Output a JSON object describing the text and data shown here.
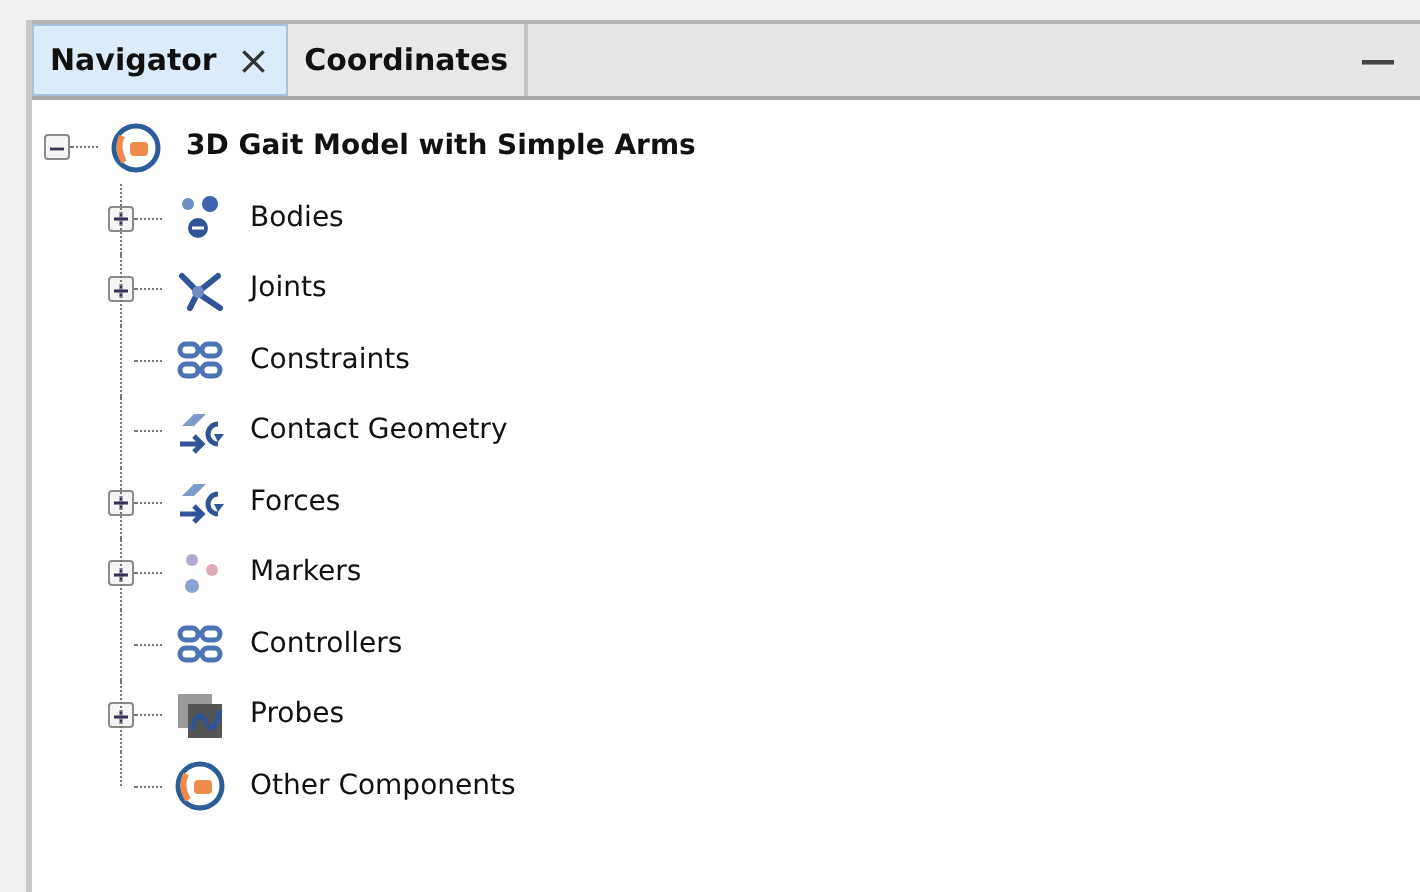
{
  "tabs": [
    {
      "label": "Navigator",
      "selected": true,
      "close": "×"
    },
    {
      "label": "Coordinates",
      "selected": false
    }
  ],
  "minimize": "—",
  "tree": {
    "label": "3D Gait Model with Simple Arms",
    "kind": "opensim",
    "expanded": true,
    "children": [
      {
        "label": "Bodies",
        "kind": "bodies",
        "expanded": false
      },
      {
        "label": "Joints",
        "kind": "joints",
        "expanded": false
      },
      {
        "label": "Constraints",
        "kind": "links"
      },
      {
        "label": "Contact Geometry",
        "kind": "forces"
      },
      {
        "label": "Forces",
        "kind": "forces",
        "expanded": false
      },
      {
        "label": "Markers",
        "kind": "markers",
        "expanded": false
      },
      {
        "label": "Controllers",
        "kind": "links"
      },
      {
        "label": "Probes",
        "kind": "probes",
        "expanded": false
      },
      {
        "label": "Other Components",
        "kind": "opensim"
      }
    ]
  }
}
